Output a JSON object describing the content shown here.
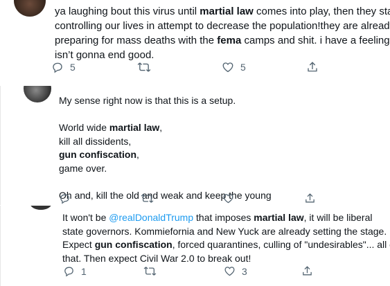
{
  "tweets": [
    {
      "lines": [
        [
          "ya laughing bout this virus until ",
          {
            "b": "martial law"
          },
          " comes into play, then they start"
        ],
        [
          "controlling our lives in attempt to decrease the population!they are already"
        ],
        [
          "preparing for mass deaths with the ",
          {
            "b": "fema"
          },
          " camps and shit. i have a feeling this"
        ],
        [
          "isn’t gonna end good."
        ]
      ],
      "actions": {
        "reply_count": "5",
        "retweet_count": "",
        "like_count": "5"
      }
    },
    {
      "lines": [
        [
          "My sense right now is that this is a setup."
        ],
        [
          ""
        ],
        [
          "World wide ",
          {
            "b": "martial law"
          },
          ","
        ],
        [
          "kill all dissidents,"
        ],
        [
          {
            "b": "gun confiscation"
          },
          ","
        ],
        [
          "game over."
        ],
        [
          ""
        ],
        [
          "Oh and, kill the old and weak and keep the young"
        ]
      ],
      "actions": {
        "reply_count": "",
        "retweet_count": "",
        "like_count": ""
      }
    },
    {
      "lines": [
        [
          "It won't be ",
          {
            "m": "@realDonaldTrump"
          },
          " that imposes ",
          {
            "b": "martial law"
          },
          ", it will be liberal"
        ],
        [
          "state governors. Kommiefornia and New Yuck are already setting the stage."
        ],
        [
          "Expect ",
          {
            "b": "gun confiscation"
          },
          ", forced quarantines, culling of \"undesirables\"... all of"
        ],
        [
          "that. Then expect Civil War 2.0 to break out!"
        ]
      ],
      "actions": {
        "reply_count": "1",
        "retweet_count": "",
        "like_count": "3"
      }
    }
  ]
}
